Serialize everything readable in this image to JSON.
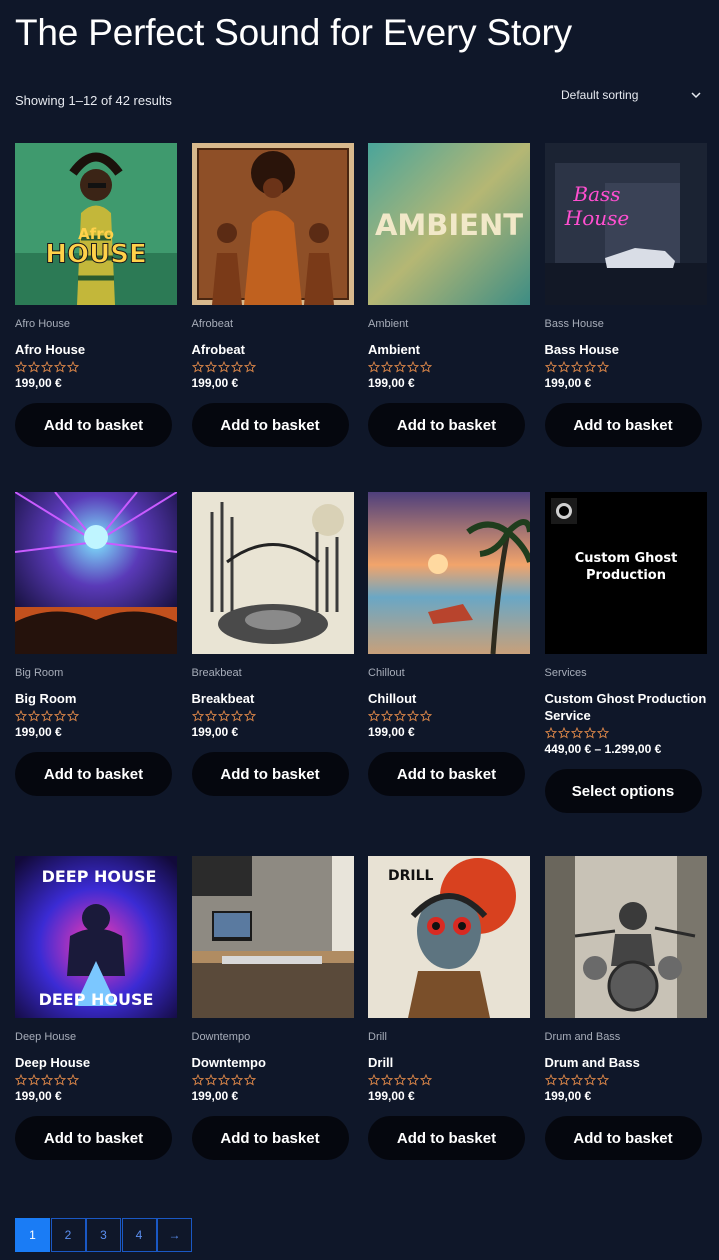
{
  "page": {
    "title": "The Perfect Sound for Every Story",
    "result_count": "Showing 1–12 of 42 results",
    "sorting": {
      "selected": "Default sorting",
      "icon": "chevron-down-icon"
    }
  },
  "colors": {
    "background": "#0f1729",
    "button_bg": "#05070e",
    "star_outline": "#e0894a",
    "pagination_active": "#1a7cf5",
    "pagination_border": "#1a58c4"
  },
  "products": [
    {
      "category": "Afro House",
      "name": "Afro House",
      "price": "199,00 €",
      "rating": 0,
      "button": "Add to basket",
      "thumb_text": [
        "Afro",
        "HOUSE"
      ]
    },
    {
      "category": "Afrobeat",
      "name": "Afrobeat",
      "price": "199,00 €",
      "rating": 0,
      "button": "Add to basket",
      "thumb_text": []
    },
    {
      "category": "Ambient",
      "name": "Ambient",
      "price": "199,00 €",
      "rating": 0,
      "button": "Add to basket",
      "thumb_text": [
        "AMBIENT"
      ]
    },
    {
      "category": "Bass House",
      "name": "Bass House",
      "price": "199,00 €",
      "rating": 0,
      "button": "Add to basket",
      "thumb_text": [
        "Bass",
        "House"
      ]
    },
    {
      "category": "Big Room",
      "name": "Big Room",
      "price": "199,00 €",
      "rating": 0,
      "button": "Add to basket",
      "thumb_text": []
    },
    {
      "category": "Breakbeat",
      "name": "Breakbeat",
      "price": "199,00 €",
      "rating": 0,
      "button": "Add to basket",
      "thumb_text": []
    },
    {
      "category": "Chillout",
      "name": "Chillout",
      "price": "199,00 €",
      "rating": 0,
      "button": "Add to basket",
      "thumb_text": []
    },
    {
      "category": "Services",
      "name": "Custom Ghost Production Service",
      "price": "449,00 € – 1.299,00 €",
      "rating": 0,
      "button": "Select options",
      "thumb_text": [
        "Custom Ghost",
        "Production"
      ]
    },
    {
      "category": "Deep House",
      "name": "Deep House",
      "price": "199,00 €",
      "rating": 0,
      "button": "Add to basket",
      "thumb_text": [
        "DEEP HOUSE",
        "DEEP HOUSE"
      ]
    },
    {
      "category": "Downtempo",
      "name": "Downtempo",
      "price": "199,00 €",
      "rating": 0,
      "button": "Add to basket",
      "thumb_text": []
    },
    {
      "category": "Drill",
      "name": "Drill",
      "price": "199,00 €",
      "rating": 0,
      "button": "Add to basket",
      "thumb_text": [
        "DRILL"
      ]
    },
    {
      "category": "Drum and Bass",
      "name": "Drum and Bass",
      "price": "199,00 €",
      "rating": 0,
      "button": "Add to basket",
      "thumb_text": []
    }
  ],
  "pagination": {
    "pages": [
      "1",
      "2",
      "3",
      "4"
    ],
    "current": "1",
    "next": "→"
  }
}
